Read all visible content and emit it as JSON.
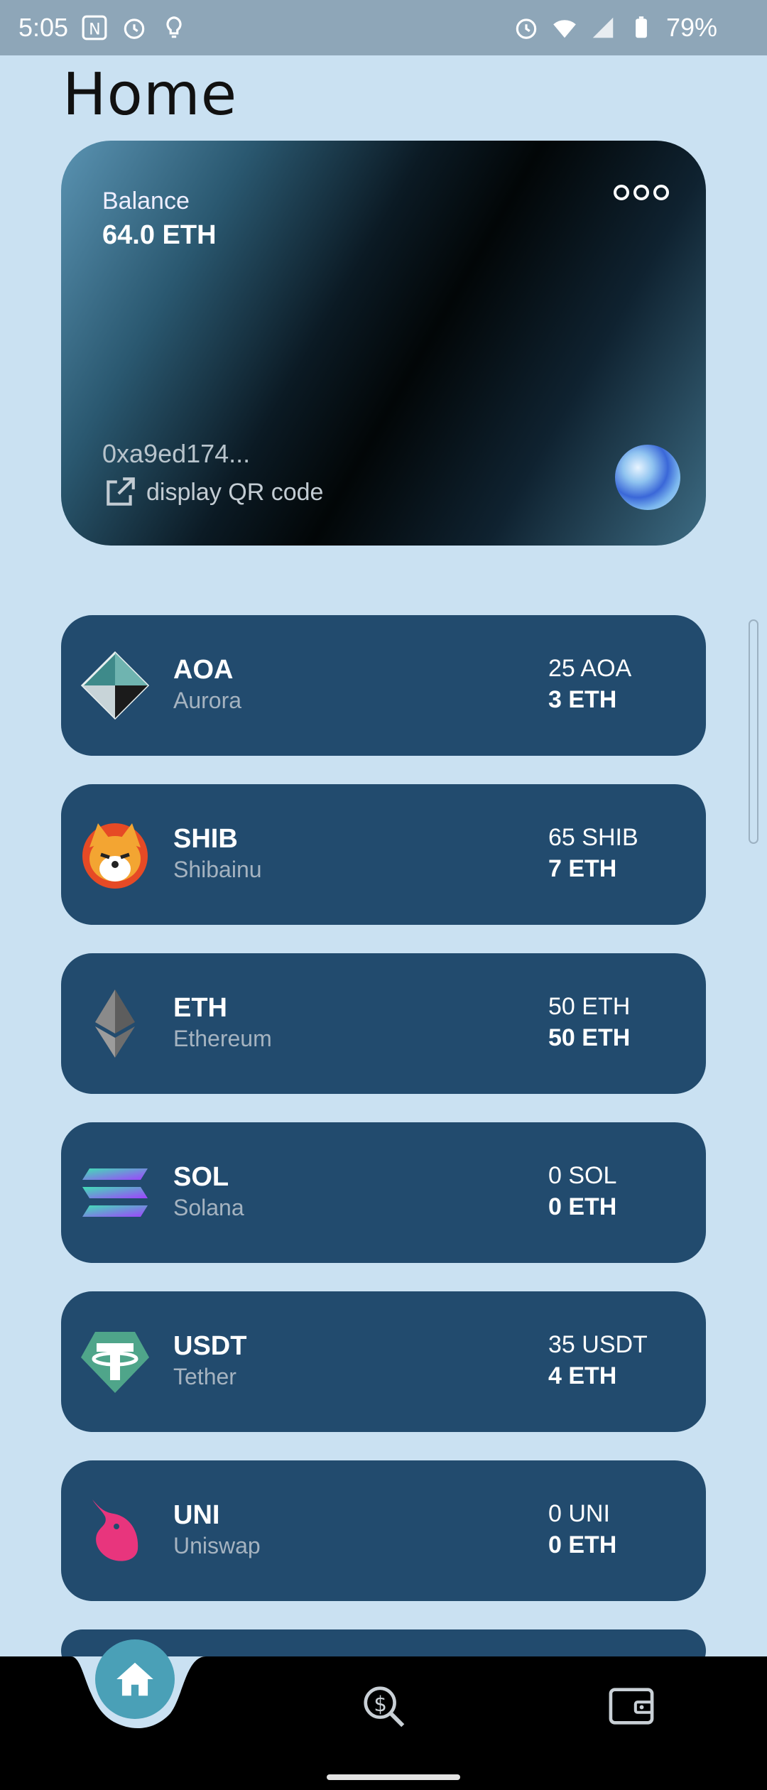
{
  "status_bar": {
    "time": "5:05",
    "battery": "79%"
  },
  "page": {
    "title": "Home"
  },
  "balance_card": {
    "label": "Balance",
    "value": "64.0 ETH",
    "address": "0xa9ed174...",
    "qr_label": "display QR code"
  },
  "tokens": [
    {
      "symbol": "AOA",
      "name": "Aurora",
      "amount": "25 AOA",
      "eth_value": "3 ETH",
      "icon": "aurora-icon"
    },
    {
      "symbol": "SHIB",
      "name": "Shibainu",
      "amount": "65 SHIB",
      "eth_value": "7 ETH",
      "icon": "shiba-icon"
    },
    {
      "symbol": "ETH",
      "name": "Ethereum",
      "amount": "50 ETH",
      "eth_value": "50 ETH",
      "icon": "ethereum-icon"
    },
    {
      "symbol": "SOL",
      "name": "Solana",
      "amount": "0 SOL",
      "eth_value": "0 ETH",
      "icon": "solana-icon"
    },
    {
      "symbol": "USDT",
      "name": "Tether",
      "amount": "35 USDT",
      "eth_value": "4 ETH",
      "icon": "tether-icon"
    },
    {
      "symbol": "UNI",
      "name": "Uniswap",
      "amount": "0 UNI",
      "eth_value": "0 ETH",
      "icon": "uniswap-icon"
    }
  ],
  "nav": {
    "items": [
      "home-icon",
      "search-dollar-icon",
      "wallet-icon"
    ]
  },
  "colors": {
    "background": "#cae1f2",
    "card": "#224b6e",
    "accent": "#4aa0b7"
  }
}
